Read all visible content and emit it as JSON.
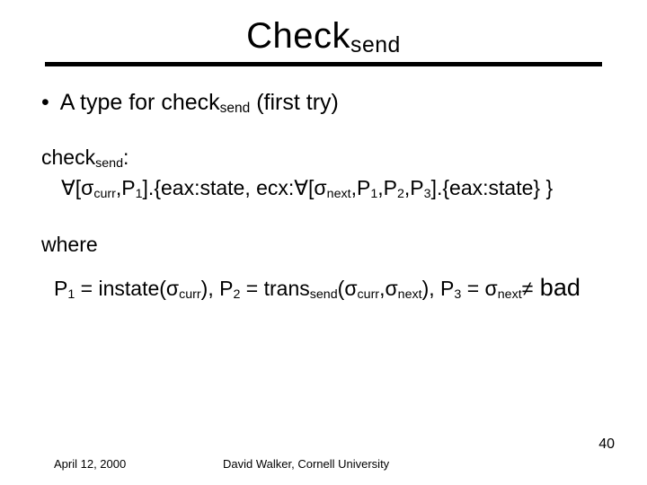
{
  "title": {
    "main": "Check",
    "sub": "send"
  },
  "bullet": {
    "pre": "A type for check",
    "sub": "send",
    "post": " (first try)"
  },
  "sig": {
    "head_pre": "check",
    "head_sub": "send",
    "head_post": ":",
    "l2_a": "∀[σ",
    "l2_b": "curr",
    "l2_c": ",P",
    "l2_d": "1",
    "l2_e": "].{eax:state, ecx:∀[σ",
    "l2_f": "next",
    "l2_g": ",P",
    "l2_h": "1",
    "l2_i": ",P",
    "l2_j": "2",
    "l2_k": ",P",
    "l2_l": "3",
    "l2_m": "].{eax:state} }"
  },
  "where": "where",
  "defs": {
    "a": "P",
    "b": "1",
    "c": " = instate(σ",
    "d": "curr",
    "e": "), P",
    "f": "2",
    "g": " = trans",
    "h": "send",
    "i": "(σ",
    "j": "curr",
    "k": ",σ",
    "l": "next",
    "m": "), P",
    "n": "3",
    "o": " = σ",
    "p": "next",
    "q": "≠",
    "r": " bad"
  },
  "footer": {
    "date": "April 12, 2000",
    "author": "David Walker, Cornell University",
    "page": "40"
  }
}
